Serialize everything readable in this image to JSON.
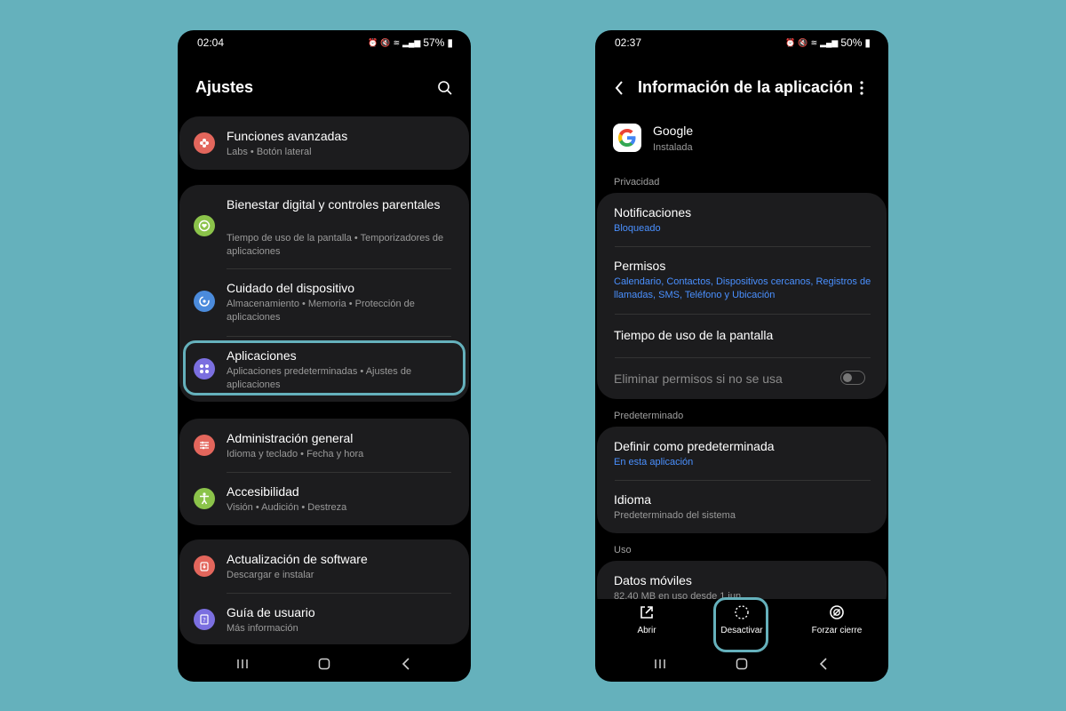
{
  "left": {
    "time": "02:04",
    "battery": "57%",
    "title": "Ajustes",
    "items": [
      {
        "title": "Funciones avanzadas",
        "sub": "Labs • Botón lateral"
      },
      {
        "title": "Bienestar digital y controles parentales",
        "sub": "Tiempo de uso de la pantalla • Temporizadores de aplicaciones"
      },
      {
        "title": "Cuidado del dispositivo",
        "sub": "Almacenamiento • Memoria • Protección de aplicaciones"
      },
      {
        "title": "Aplicaciones",
        "sub": "Aplicaciones predeterminadas • Ajustes de aplicaciones"
      },
      {
        "title": "Administración general",
        "sub": "Idioma y teclado • Fecha y hora"
      },
      {
        "title": "Accesibilidad",
        "sub": "Visión • Audición • Destreza"
      },
      {
        "title": "Actualización de software",
        "sub": "Descargar e instalar"
      },
      {
        "title": "Guía de usuario",
        "sub": "Más información"
      }
    ],
    "colors": {
      "orange": "#e3665c",
      "green": "#8bc34a",
      "blue": "#4b8bdc",
      "purple": "#7b6fe0"
    }
  },
  "right": {
    "time": "02:37",
    "battery": "50%",
    "title": "Información de la aplicación",
    "app_name": "Google",
    "app_status": "Instalada",
    "sections": {
      "privacy": "Privacidad",
      "default": "Predeterminado",
      "usage": "Uso"
    },
    "items": {
      "notifications": {
        "title": "Notificaciones",
        "sub": "Bloqueado"
      },
      "permissions": {
        "title": "Permisos",
        "sub": "Calendario, Contactos, Dispositivos cercanos, Registros de llamadas, SMS, Teléfono y Ubicación"
      },
      "screen_time": {
        "title": "Tiempo de uso de la pantalla"
      },
      "remove_perms": {
        "title": "Eliminar permisos si no se usa"
      },
      "set_default": {
        "title": "Definir como predeterminada",
        "sub": "En esta aplicación"
      },
      "language": {
        "title": "Idioma",
        "sub": "Predeterminado del sistema"
      },
      "mobile_data": {
        "title": "Datos móviles",
        "sub": "82,40 MB en uso desde 1 jun."
      }
    },
    "actions": {
      "open": "Abrir",
      "disable": "Desactivar",
      "force_stop": "Forzar cierre"
    }
  }
}
